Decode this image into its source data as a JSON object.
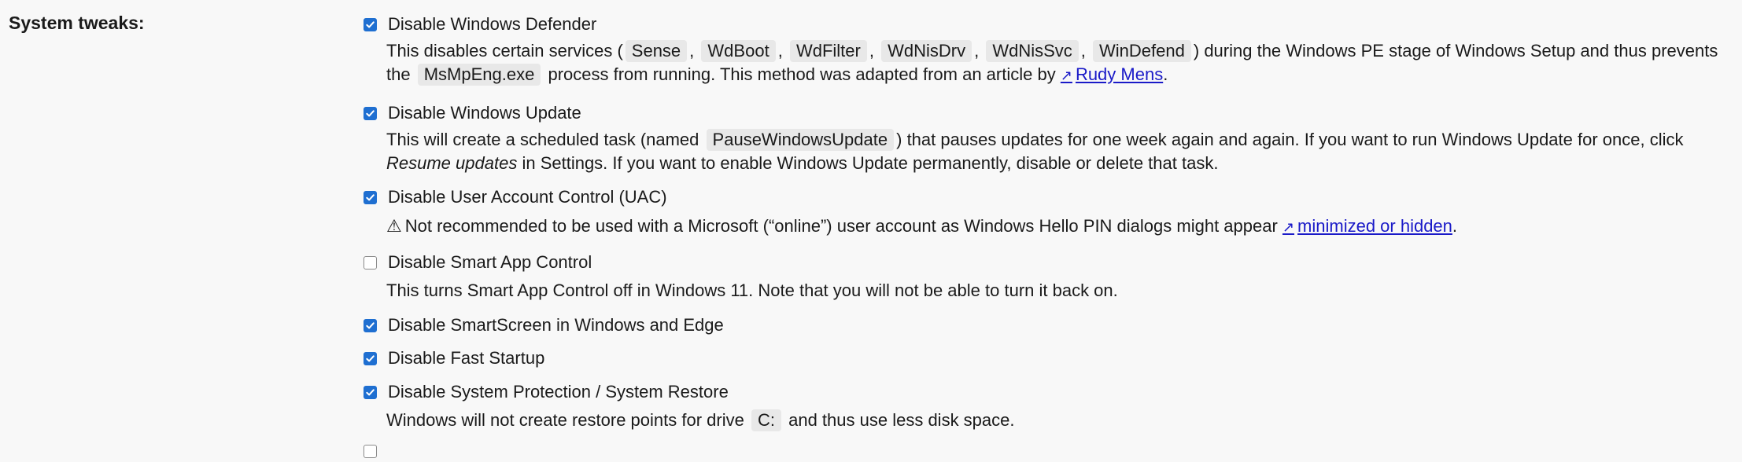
{
  "section": {
    "label": "System tweaks:"
  },
  "colors": {
    "checkbox_checked": "#1f6fd1",
    "link": "#1a1ac8",
    "code_bg": "#e8e8e8",
    "background": "#f8f8f8"
  },
  "options": {
    "defender": {
      "label": "Disable Windows Defender",
      "checked": true,
      "desc": {
        "t1": "This disables certain services (",
        "codes": [
          "Sense",
          "WdBoot",
          "WdFilter",
          "WdNisDrv",
          "WdNisSvc",
          "WinDefend"
        ],
        "sep": ",",
        "t2": ") during the Windows PE stage of Windows Setup and thus prevents the",
        "code_exe": "MsMpEng.exe",
        "t3": "process from running. This method was adapted from an article by",
        "link_icon": "↗",
        "link": "Rudy Mens",
        "t4": "."
      }
    },
    "update": {
      "label": "Disable Windows Update",
      "checked": true,
      "desc": {
        "t1": "This will create a scheduled task (named",
        "code": "PauseWindowsUpdate",
        "t2": ") that pauses updates for one week again and again. If you want to run Windows Update for once, click",
        "em": "Resume updates",
        "t3": "in Settings. If you want to enable Windows Update permanently, disable or delete that task."
      }
    },
    "uac": {
      "label": "Disable User Account Control (UAC)",
      "checked": true,
      "desc": {
        "warn_icon": "⚠",
        "t1": "Not recommended to be used with a Microsoft (“online”) user account as Windows Hello PIN dialogs might appear",
        "link_icon": "↗",
        "link": "minimized or hidden",
        "t2": "."
      }
    },
    "smartapp": {
      "label": "Disable Smart App Control",
      "checked": false,
      "desc": {
        "t1": "This turns Smart App Control off in Windows 11. Note that you will not be able to turn it back on."
      }
    },
    "smartscreen": {
      "label": "Disable SmartScreen in Windows and Edge",
      "checked": true
    },
    "faststartup": {
      "label": "Disable Fast Startup",
      "checked": true
    },
    "sysprotect": {
      "label": "Disable System Protection / System Restore",
      "checked": true,
      "desc": {
        "t1": "Windows will not create restore points for drive",
        "code": "C:",
        "t2": "and thus use less disk space."
      }
    }
  }
}
